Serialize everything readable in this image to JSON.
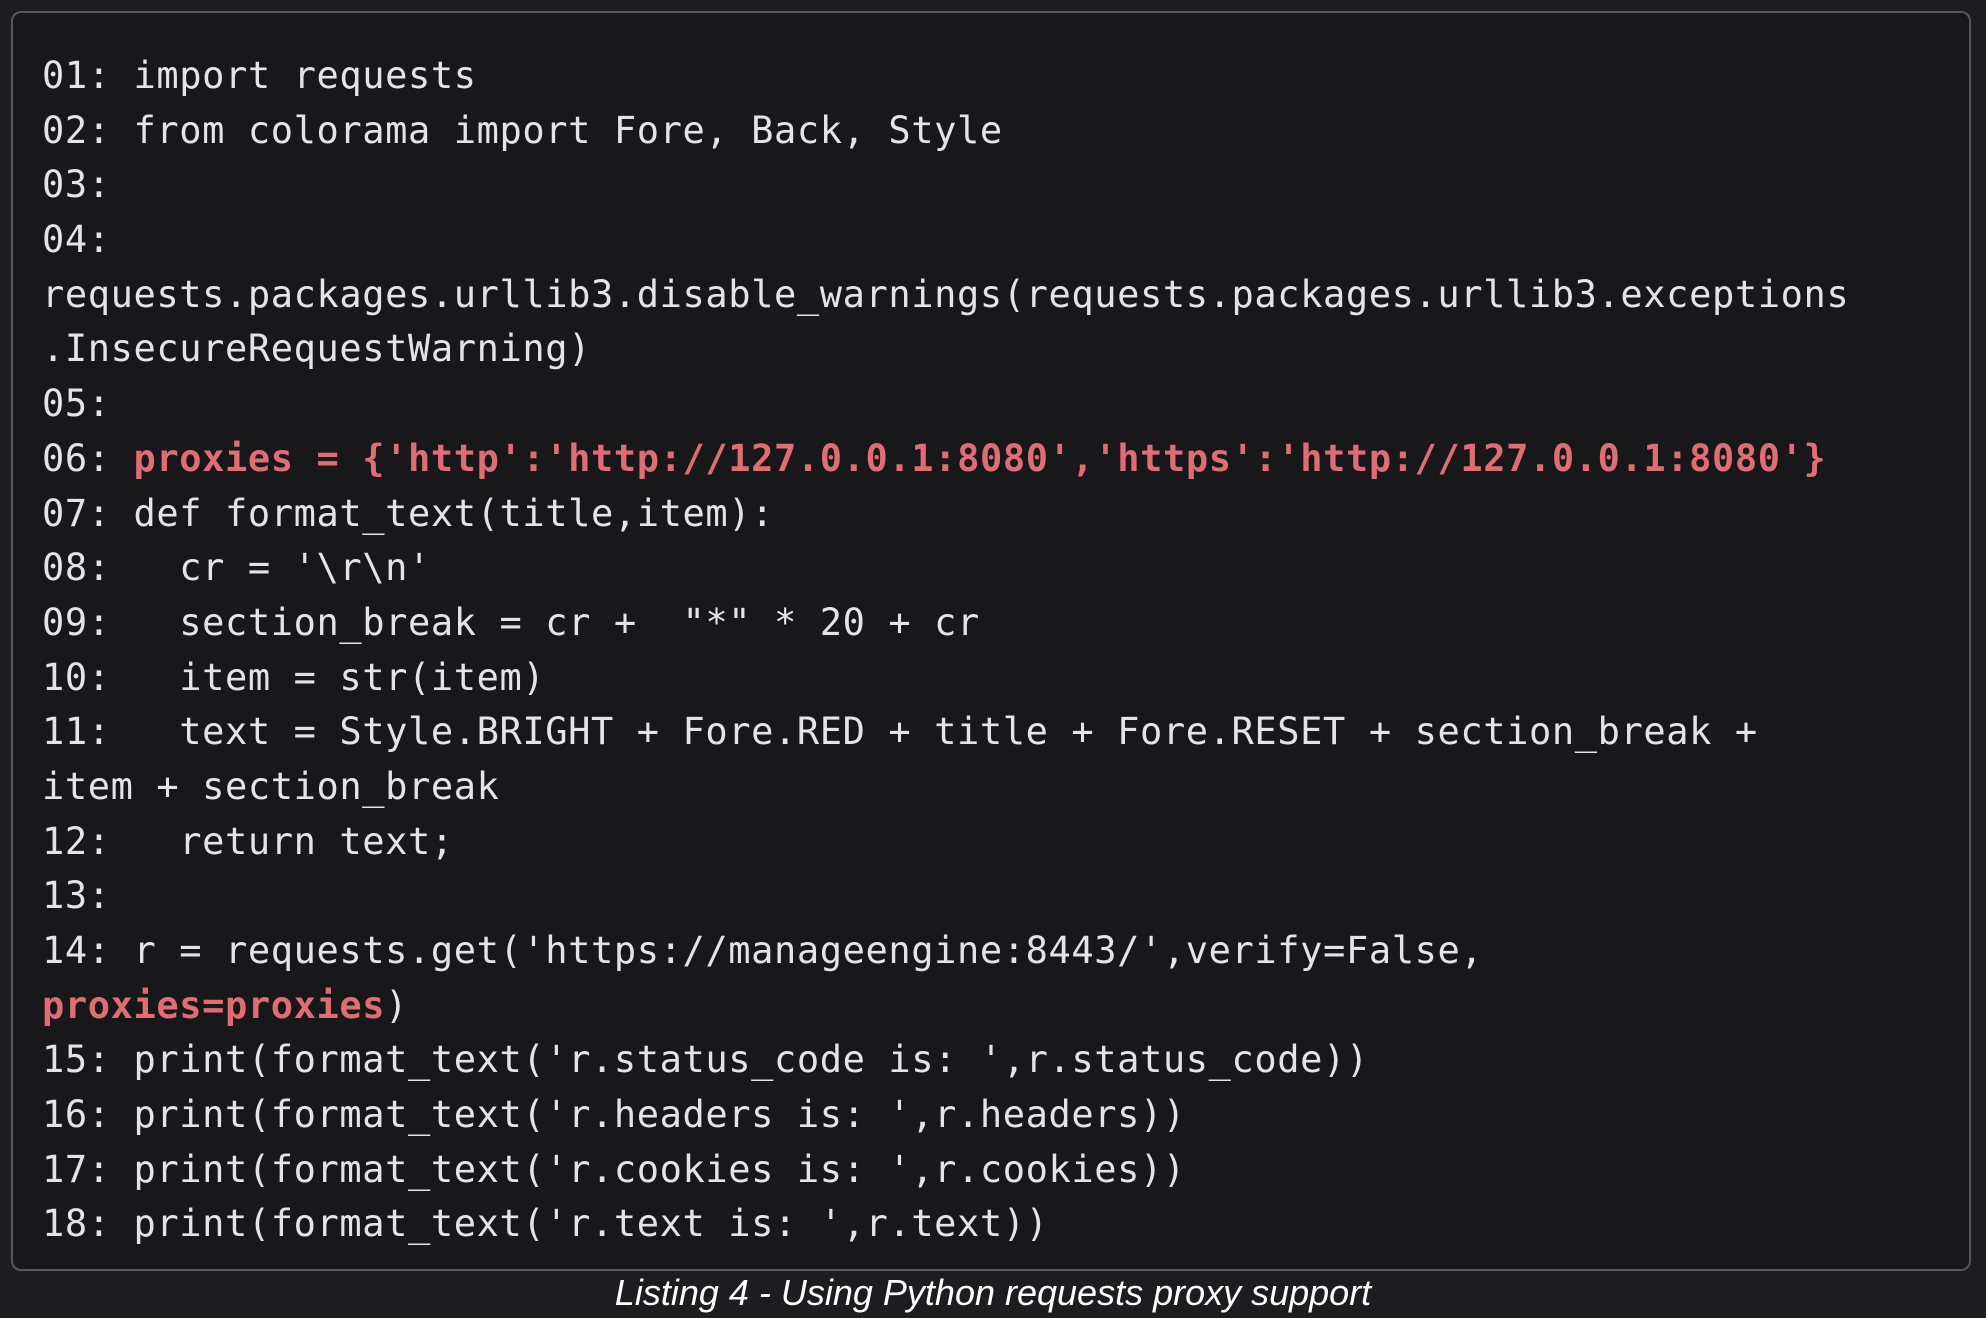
{
  "code_lines": [
    {
      "num": "01:",
      "text": " import requests"
    },
    {
      "num": "02:",
      "text": " from colorama import Fore, Back, Style"
    },
    {
      "num": "03:",
      "text": ""
    },
    {
      "num": "04:",
      "text": ""
    },
    {
      "num": "",
      "text": "requests.packages.urllib3.disable_warnings(requests.packages.urllib3.exceptions"
    },
    {
      "num": "",
      "text": ".InsecureRequestWarning)"
    },
    {
      "num": "05:",
      "text": ""
    },
    {
      "num": "06:",
      "text": " ",
      "highlight": "proxies = {'http':'http://127.0.0.1:8080','https':'http://127.0.0.1:8080'}"
    },
    {
      "num": "07:",
      "text": " def format_text(title,item):"
    },
    {
      "num": "08:",
      "text": "   cr = '\\r\\n'"
    },
    {
      "num": "09:",
      "text": "   section_break = cr +  \"*\" * 20 + cr"
    },
    {
      "num": "10:",
      "text": "   item = str(item)"
    },
    {
      "num": "11:",
      "text": "   text = Style.BRIGHT + Fore.RED + title + Fore.RESET + section_break +"
    },
    {
      "num": "",
      "text": "item + section_break"
    },
    {
      "num": "12:",
      "text": "   return text;"
    },
    {
      "num": "13:",
      "text": ""
    },
    {
      "num": "14:",
      "text": " r = requests.get('https://manageengine:8443/',verify=False,"
    },
    {
      "num": "",
      "text": "",
      "highlight": "proxies=proxies",
      "after": ")"
    },
    {
      "num": "15:",
      "text": " print(format_text('r.status_code is: ',r.status_code))"
    },
    {
      "num": "16:",
      "text": " print(format_text('r.headers is: ',r.headers))"
    },
    {
      "num": "17:",
      "text": " print(format_text('r.cookies is: ',r.cookies))"
    },
    {
      "num": "18:",
      "text": " print(format_text('r.text is: ',r.text))"
    }
  ],
  "caption": "Listing 4 - Using Python requests proxy support",
  "colors": {
    "background": "#18181b",
    "border": "#56565c",
    "text": "#e4e4e6",
    "highlight": "#e06c75",
    "caption": "#ffffff"
  }
}
